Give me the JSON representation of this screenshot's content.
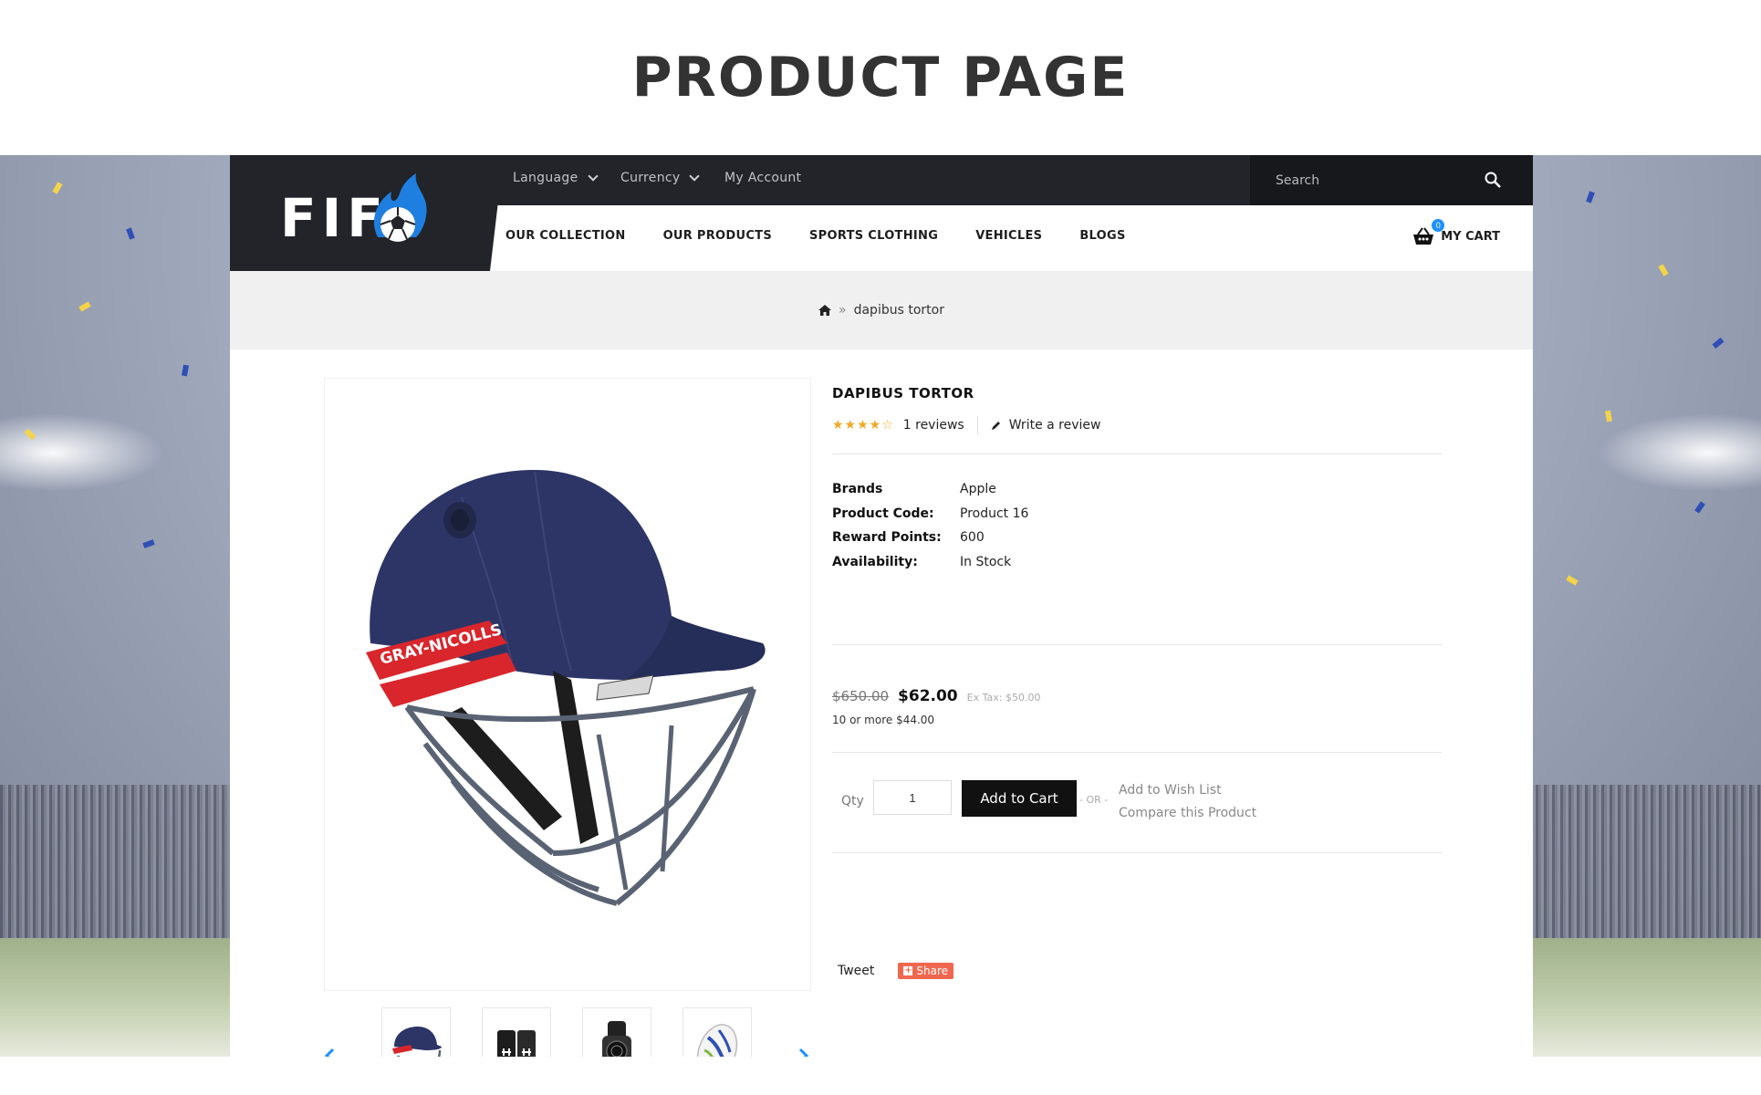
{
  "page_heading": "PRODUCT PAGE",
  "brand": {
    "logo_text": "FIF"
  },
  "topbar": {
    "language_label": "Language",
    "currency_label": "Currency",
    "account_label": "My Account",
    "search_placeholder": "Search"
  },
  "nav": {
    "items": [
      {
        "label": "OUR COLLECTION"
      },
      {
        "label": "OUR PRODUCTS"
      },
      {
        "label": "SPORTS CLOTHING"
      },
      {
        "label": "VEHICLES"
      },
      {
        "label": "BLOGS"
      }
    ],
    "cart_label": "MY CART",
    "cart_count": "0"
  },
  "breadcrumb": {
    "separator": "»",
    "current": "dapibus tortor"
  },
  "product": {
    "title": "DAPIBUS TORTOR",
    "stars": "★★★★☆",
    "reviews_label": "1 reviews",
    "write_review_label": "Write a review",
    "specs": [
      {
        "label": "Brands",
        "value": "Apple"
      },
      {
        "label": "Product Code:",
        "value": "Product 16"
      },
      {
        "label": "Reward Points:",
        "value": "600"
      },
      {
        "label": "Availability:",
        "value": "In Stock"
      }
    ],
    "old_price": "$650.00",
    "new_price": "$62.00",
    "ex_tax": "Ex Tax: $50.00",
    "bulk_price": "10 or more $44.00",
    "qty_label": "Qty",
    "qty_value": "1",
    "add_to_cart_label": "Add to Cart",
    "or_label": "- OR -",
    "wishlist_label": "Add to Wish List",
    "compare_label": "Compare this Product",
    "tweet_label": "Tweet",
    "share_label": "Share"
  },
  "colors": {
    "header_dark": "#222429",
    "accent_blue": "#1e90ff",
    "star_gold": "#f5a623",
    "share_orange": "#f0674f"
  },
  "thumbnails": [
    {
      "icon": "helmet-thumb-icon"
    },
    {
      "icon": "wristband-thumb-icon"
    },
    {
      "icon": "watch-thumb-icon"
    },
    {
      "icon": "rugby-ball-thumb-icon"
    }
  ]
}
